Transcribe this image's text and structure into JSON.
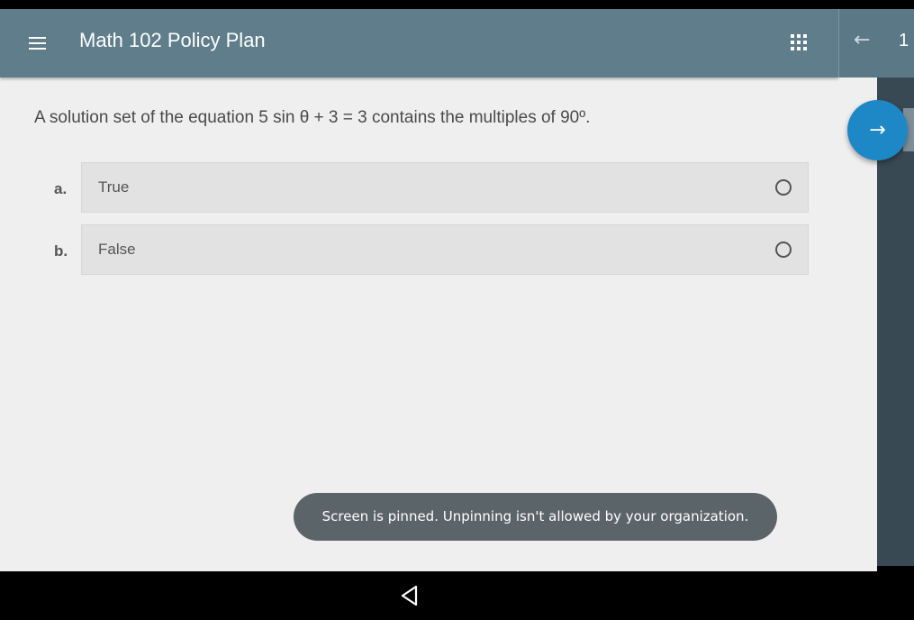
{
  "appbar": {
    "title": "Math 102 Policy Plan",
    "page_number": "1",
    "menu_icon": "menu-icon",
    "grid_icon": "grid-icon",
    "back_icon": "arrow-left-icon",
    "back_glyph": "←",
    "color": "#5f7d8b"
  },
  "question": {
    "text": "A solution set of the equation 5 sin θ + 3 = 3 contains the multiples of 90º."
  },
  "options": [
    {
      "letter": "a.",
      "label": "True",
      "selected": false
    },
    {
      "letter": "b.",
      "label": "False",
      "selected": false
    }
  ],
  "next_button": {
    "icon": "arrow-right-icon",
    "glyph": "→",
    "color": "#1e88c7"
  },
  "toast": {
    "message": "Screen is pinned. Unpinning isn't allowed by your organization."
  },
  "system_nav": {
    "back_icon": "triangle-back-icon"
  }
}
